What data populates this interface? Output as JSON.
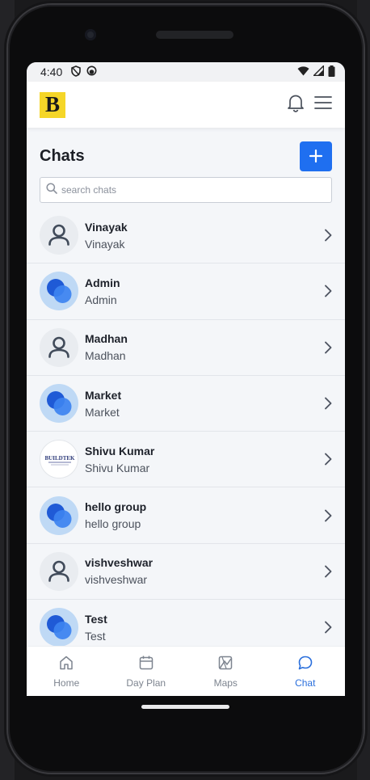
{
  "statusbar": {
    "time": "4:40"
  },
  "appbar": {
    "logo_letter": "B"
  },
  "header": {
    "title": "Chats",
    "add_label": "+"
  },
  "search": {
    "placeholder": "search chats",
    "value": ""
  },
  "chats": [
    {
      "name": "Vinayak",
      "subtitle": "Vinayak",
      "avatar": "person"
    },
    {
      "name": "Admin",
      "subtitle": "Admin",
      "avatar": "group"
    },
    {
      "name": "Madhan",
      "subtitle": "Madhan",
      "avatar": "person"
    },
    {
      "name": "Market",
      "subtitle": "Market",
      "avatar": "group"
    },
    {
      "name": "Shivu Kumar",
      "subtitle": "Shivu Kumar",
      "avatar": "logo",
      "logo_text": "BUILDTEK"
    },
    {
      "name": "hello group",
      "subtitle": "hello group",
      "avatar": "group"
    },
    {
      "name": "vishveshwar",
      "subtitle": "vishveshwar",
      "avatar": "person"
    },
    {
      "name": "Test",
      "subtitle": "Test",
      "avatar": "group"
    }
  ],
  "bottom_nav": [
    {
      "label": "Home",
      "icon": "home-icon",
      "active": false
    },
    {
      "label": "Day Plan",
      "icon": "calendar-icon",
      "active": false
    },
    {
      "label": "Maps",
      "icon": "map-icon",
      "active": false
    },
    {
      "label": "Chat",
      "icon": "chat-icon",
      "active": true
    }
  ],
  "colors": {
    "accent": "#1f6ff0",
    "logo_bg": "#f5d628",
    "active_nav": "#2a6fdc"
  }
}
